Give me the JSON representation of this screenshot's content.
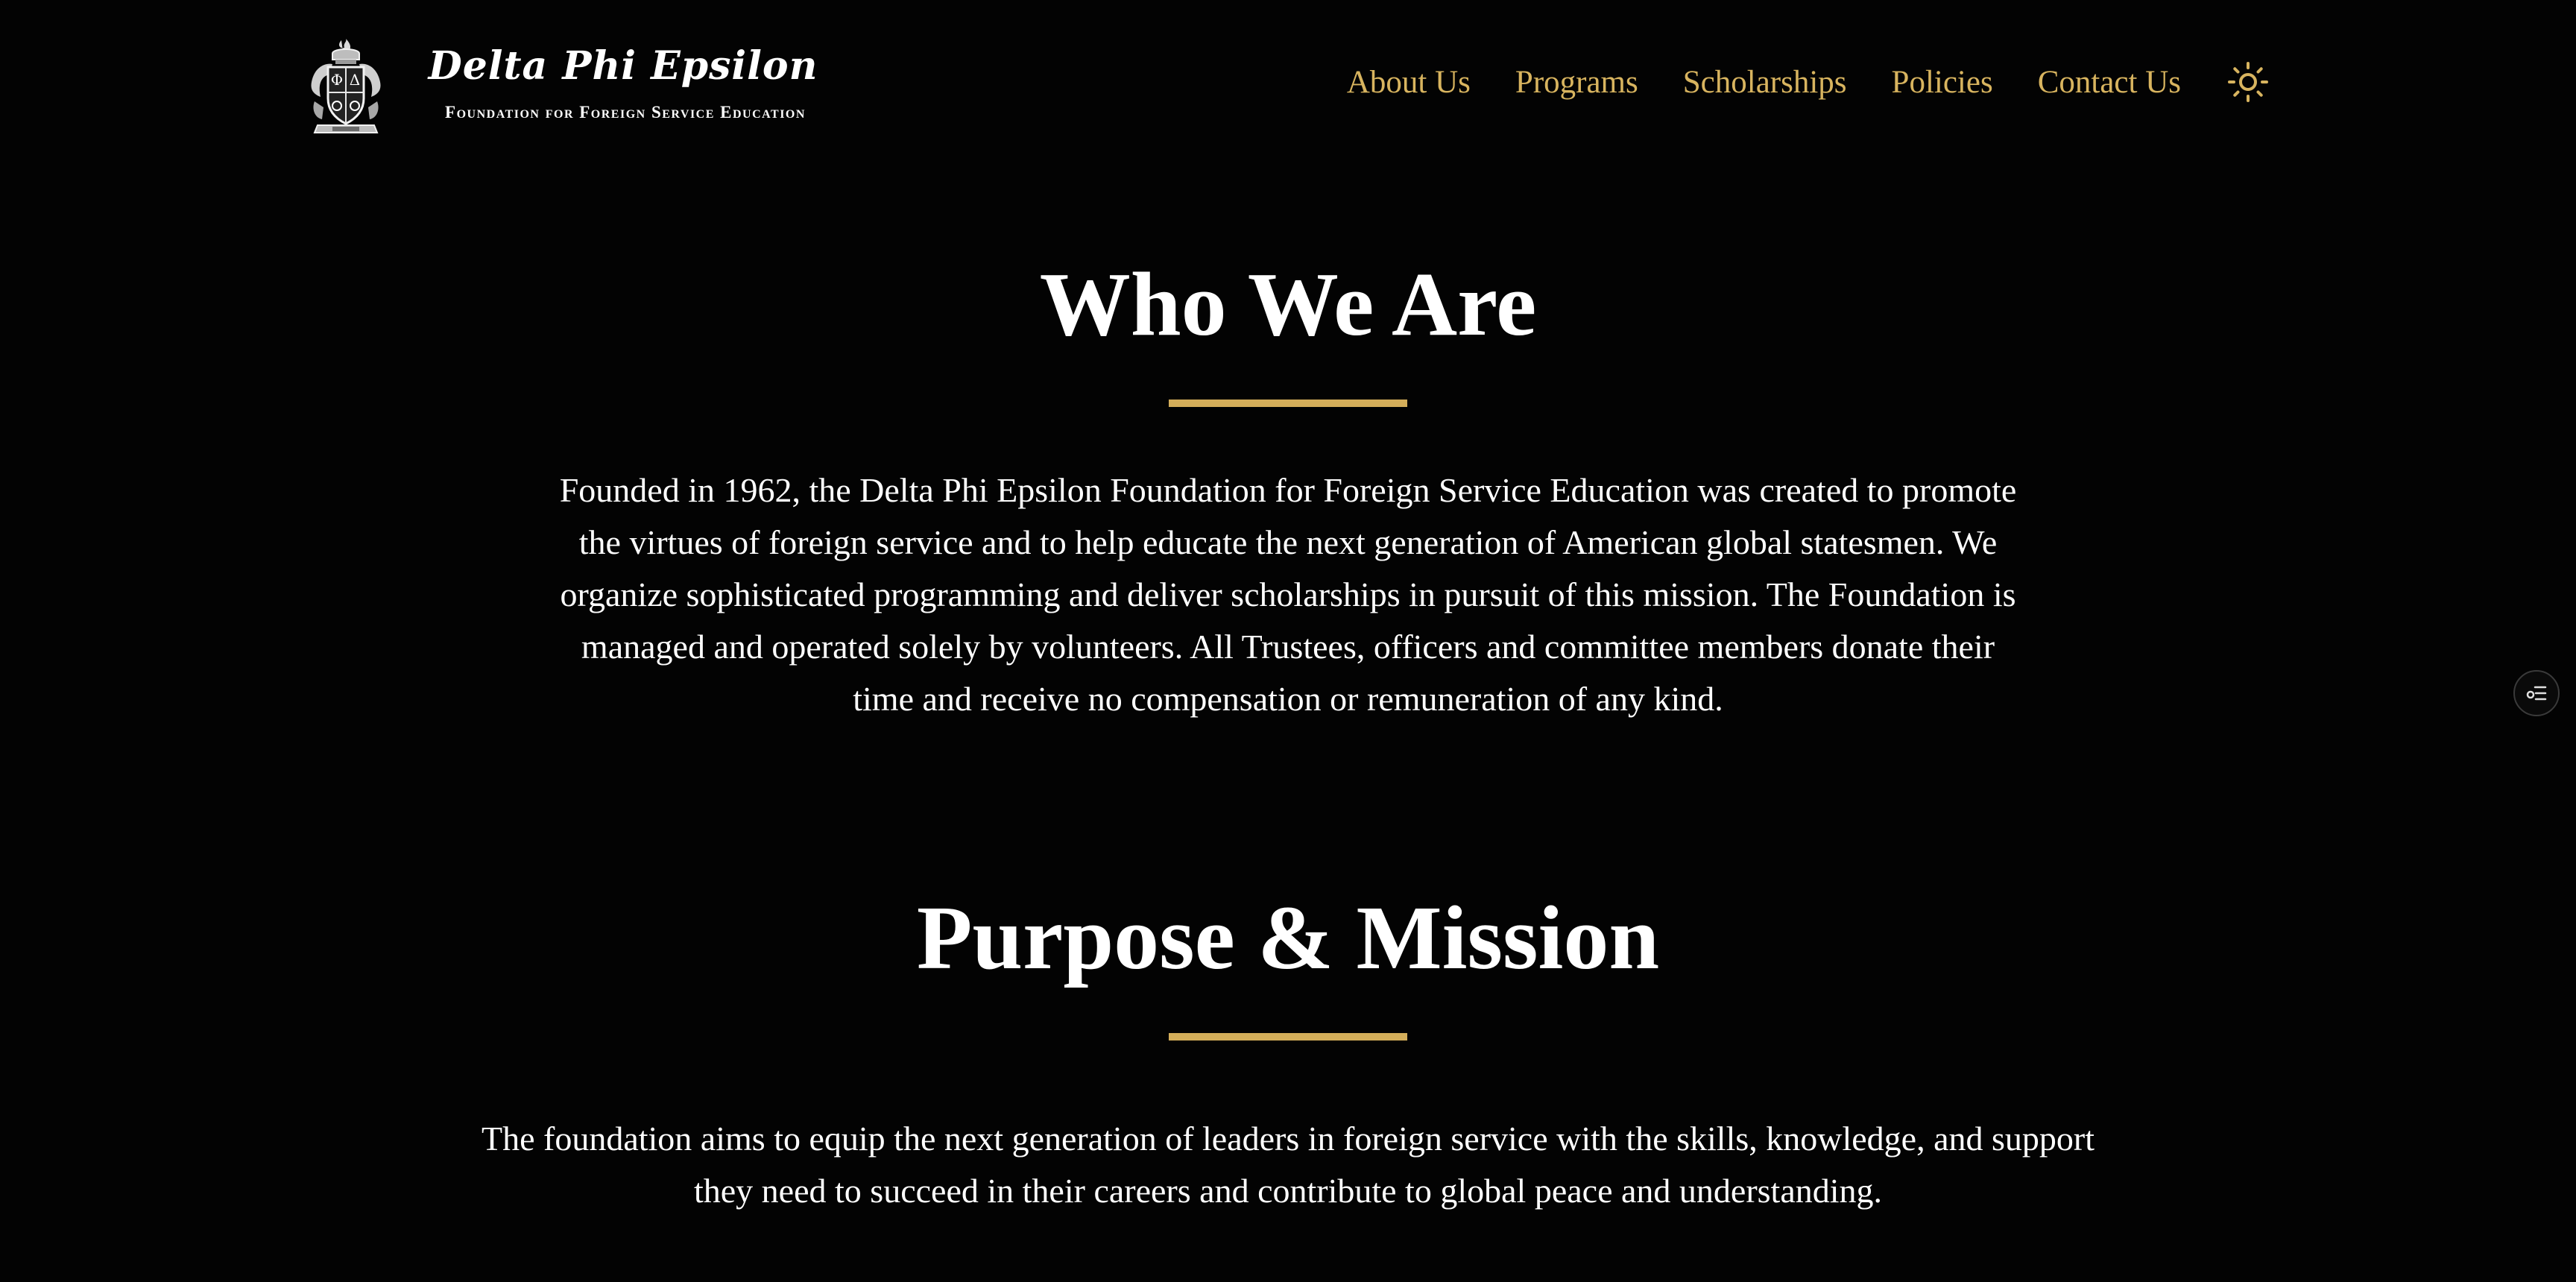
{
  "header": {
    "crest_icon": "fraternity-crest-logo",
    "brand_name": "Delta Phi Epsilon",
    "brand_subtitle": "Foundation for Foreign Service Education",
    "nav": [
      {
        "label": "About Us"
      },
      {
        "label": "Programs"
      },
      {
        "label": "Scholarships"
      },
      {
        "label": "Policies"
      },
      {
        "label": "Contact Us"
      }
    ],
    "theme_toggle_icon": "sun-icon"
  },
  "sections": [
    {
      "title": "Who We Are",
      "text": "Founded in 1962, the Delta Phi Epsilon Foundation for Foreign Service Education was created to promote the virtues of foreign service and to help educate the next generation of American global statesmen. We organize sophisticated programming and deliver scholarships in pursuit of this mission. The Foundation is managed and operated solely by volunteers. All Trustees, officers and committee members donate their time and receive no compensation or remuneration of any kind."
    },
    {
      "title": "Purpose & Mission",
      "text": "The foundation aims to equip the next generation of leaders in foreign service with the skills, knowledge, and support they need to succeed in their careers and contribute to global peace and understanding."
    }
  ],
  "floating": {
    "toc_icon": "table-of-contents-icon"
  },
  "colors": {
    "background": "#030303",
    "accent_gold": "#d8b45f",
    "text": "#ffffff"
  }
}
